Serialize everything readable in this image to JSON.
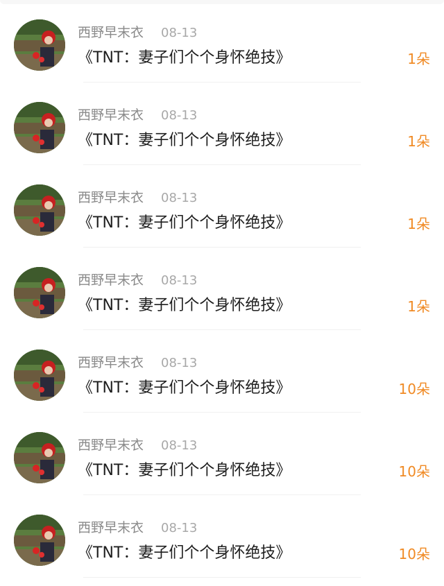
{
  "items": [
    {
      "name": "西野早末衣",
      "date": "08-13",
      "title": "《TNT：妻子们个个身怀绝技》",
      "count": "1朵"
    },
    {
      "name": "西野早末衣",
      "date": "08-13",
      "title": "《TNT：妻子们个个身怀绝技》",
      "count": "1朵"
    },
    {
      "name": "西野早末衣",
      "date": "08-13",
      "title": "《TNT：妻子们个个身怀绝技》",
      "count": "1朵"
    },
    {
      "name": "西野早末衣",
      "date": "08-13",
      "title": "《TNT：妻子们个个身怀绝技》",
      "count": "1朵"
    },
    {
      "name": "西野早末衣",
      "date": "08-13",
      "title": "《TNT：妻子们个个身怀绝技》",
      "count": "10朵"
    },
    {
      "name": "西野早末衣",
      "date": "08-13",
      "title": "《TNT：妻子们个个身怀绝技》",
      "count": "10朵"
    },
    {
      "name": "西野早末衣",
      "date": "08-13",
      "title": "《TNT：妻子们个个身怀绝技》",
      "count": "10朵"
    }
  ],
  "colors": {
    "name": "#8a8a8a",
    "date": "#a8a8a8",
    "title": "#1e1e1e",
    "count_accent": "#f08a24"
  },
  "icons": {
    "avatar": "user-avatar-photo"
  }
}
